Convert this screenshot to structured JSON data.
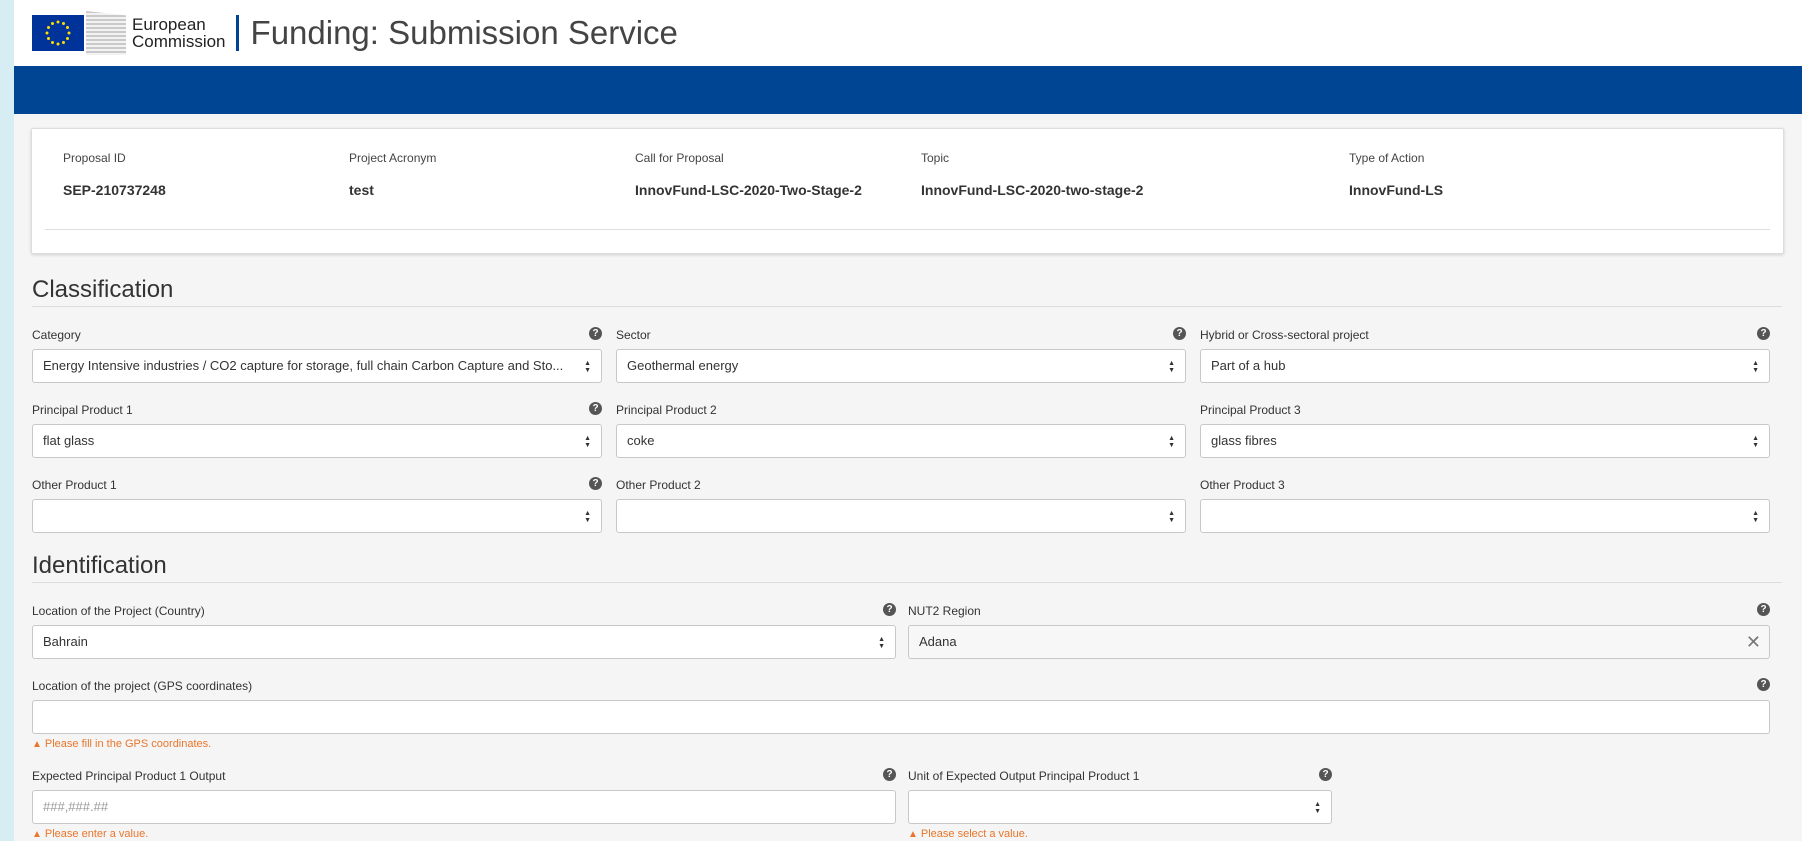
{
  "header": {
    "org_line1": "European",
    "org_line2": "Commission",
    "app_title": "Funding: Submission Service"
  },
  "proposal": {
    "fields": [
      {
        "label": "Proposal ID",
        "value": "SEP-210737248"
      },
      {
        "label": "Project Acronym",
        "value": "test"
      },
      {
        "label": "Call for Proposal",
        "value": "InnovFund-LSC-2020-Two-Stage-2"
      },
      {
        "label": "Topic",
        "value": "InnovFund-LSC-2020-two-stage-2"
      },
      {
        "label": "Type of Action",
        "value": "InnovFund-LS"
      }
    ]
  },
  "classification": {
    "title": "Classification",
    "category": {
      "label": "Category",
      "value": "Energy Intensive industries / CO2 capture for storage, full chain Carbon Capture and Sto..."
    },
    "sector": {
      "label": "Sector",
      "value": "Geothermal energy"
    },
    "hybrid": {
      "label": "Hybrid or Cross-sectoral project",
      "value": "Part of a hub"
    },
    "principal1": {
      "label": "Principal Product 1",
      "value": "flat glass"
    },
    "principal2": {
      "label": "Principal Product 2",
      "value": "coke"
    },
    "principal3": {
      "label": "Principal Product 3",
      "value": "glass fibres"
    },
    "other1": {
      "label": "Other Product 1",
      "value": ""
    },
    "other2": {
      "label": "Other Product 2",
      "value": ""
    },
    "other3": {
      "label": "Other Product 3",
      "value": ""
    }
  },
  "identification": {
    "title": "Identification",
    "country": {
      "label": "Location of the Project (Country)",
      "value": "Bahrain"
    },
    "nut2": {
      "label": "NUT2 Region",
      "value": "Adana"
    },
    "gps": {
      "label": "Location of the project (GPS coordinates)",
      "value": "",
      "warning": "Please fill in the GPS coordinates."
    },
    "output": {
      "label": "Expected Principal Product 1 Output",
      "placeholder": "###,###.##",
      "warning": "Please enter a value."
    },
    "unit": {
      "label": "Unit of Expected Output Principal Product 1",
      "value": "",
      "warning": "Please select a value."
    }
  },
  "icons": {
    "help": "question-circle-icon",
    "caret": "select-caret-icon",
    "clear": "close-icon",
    "warning": "warning-triangle-icon"
  },
  "colors": {
    "brand_blue": "#004494",
    "warning": "#e8762b"
  }
}
